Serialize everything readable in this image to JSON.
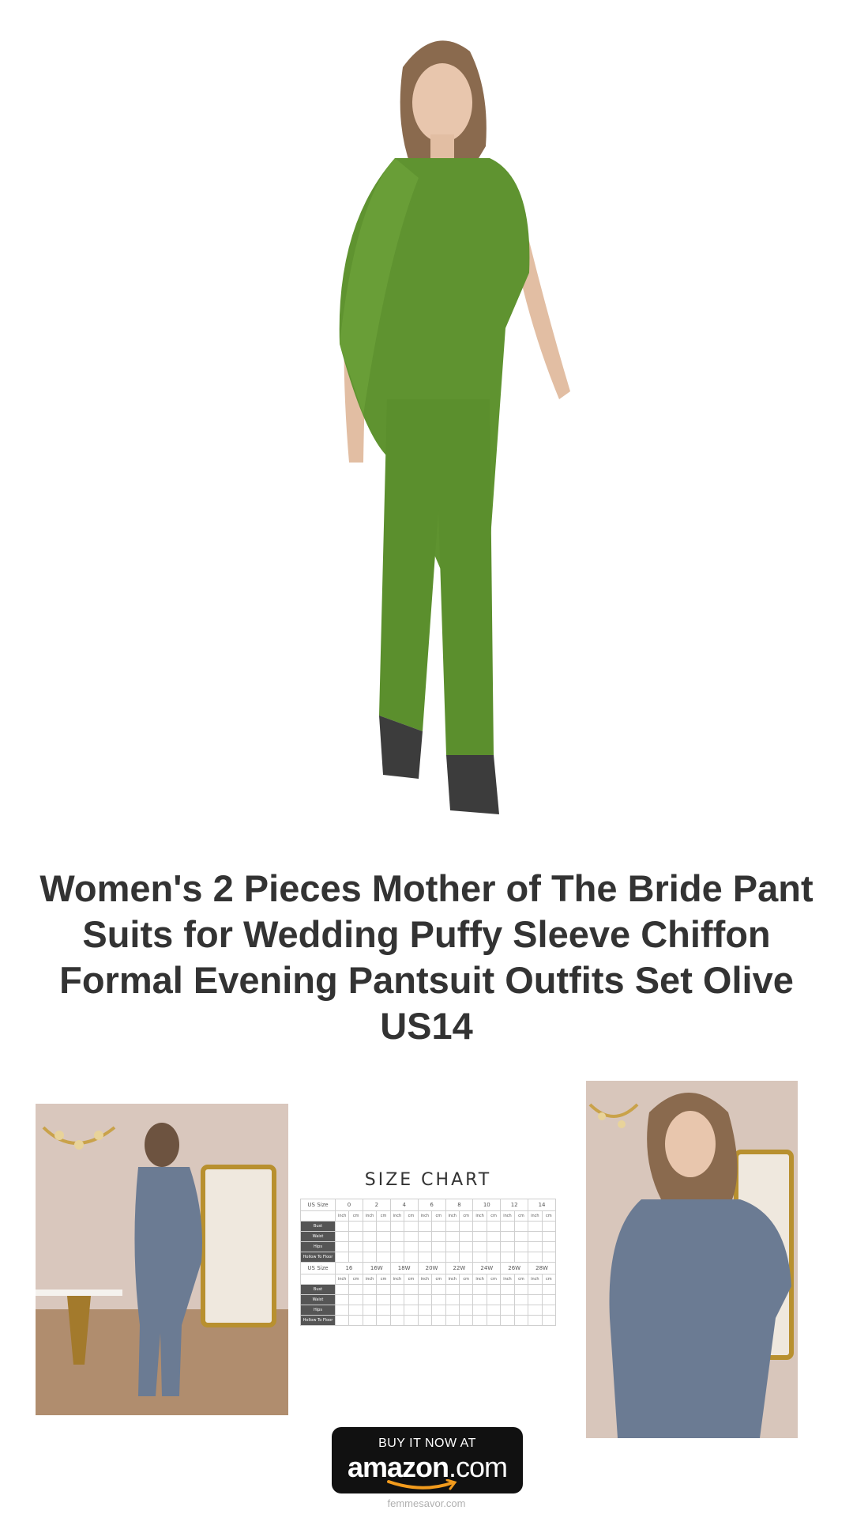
{
  "product": {
    "title": "Women's 2 Pieces Mother of The Bride Pant Suits for Wedding Puffy Sleeve Chiffon Formal Evening Pantsuit Outfits Set Olive US14",
    "main_color": "#5f9330",
    "alt_color": "#6b7b93"
  },
  "size_chart": {
    "title": "SIZE CHART",
    "units": [
      "inch",
      "cm"
    ],
    "rows": [
      "Bust",
      "Waist",
      "Hips",
      "Hollow To Floor"
    ],
    "table1": {
      "header": "US Size",
      "sizes": [
        "0",
        "2",
        "4",
        "6",
        "8",
        "10",
        "12",
        "14"
      ]
    },
    "table2": {
      "header": "US Size",
      "sizes": [
        "16",
        "16W",
        "18W",
        "20W",
        "22W",
        "24W",
        "26W",
        "28W"
      ]
    }
  },
  "cta": {
    "line1": "BUY IT NOW AT",
    "brand": "amazon",
    "suffix": ".com",
    "accent_color": "#f29b1d"
  },
  "footer": {
    "site": "femmesavor.com"
  }
}
